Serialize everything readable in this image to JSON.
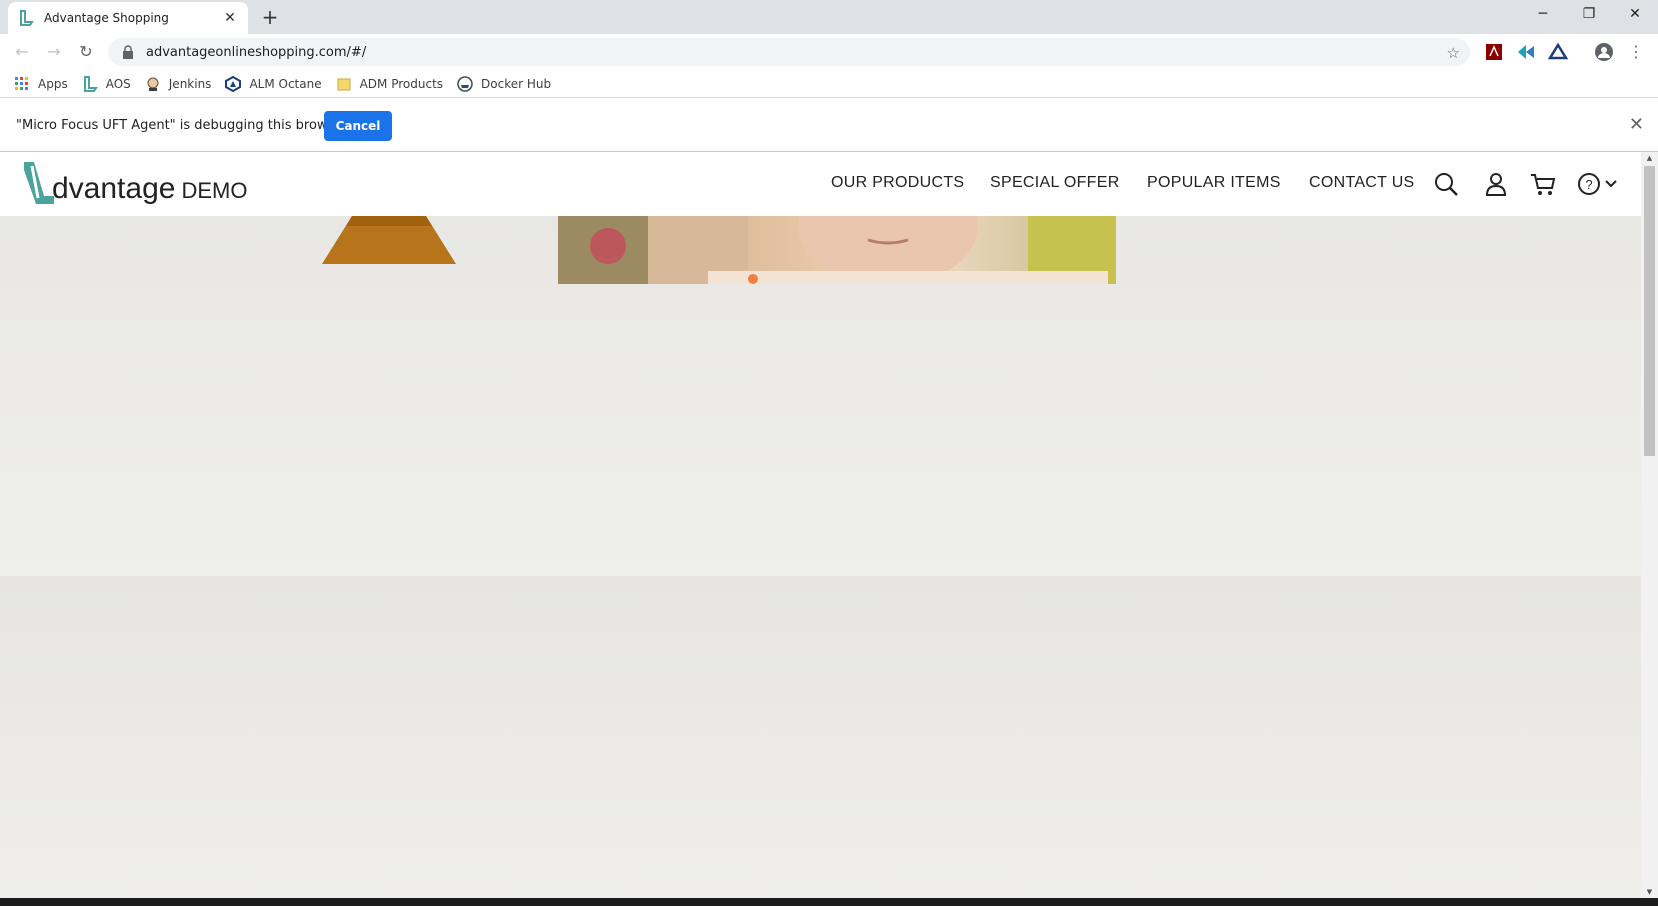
{
  "browser": {
    "tab_title": "Advantage Shopping",
    "url": "advantageonlineshopping.com/#/",
    "bookmarks": [
      "Apps",
      "AOS",
      "Jenkins",
      "ALM Octane",
      "ADM Products",
      "Docker Hub"
    ]
  },
  "infobar": {
    "message": "\"Micro Focus UFT Agent\" is debugging this browser",
    "cancel_label": "Cancel"
  },
  "site": {
    "logo_word": "dvantage",
    "logo_demo": "DEMO",
    "nav": [
      "OUR PRODUCTS",
      "SPECIAL OFFER",
      "POPULAR ITEMS",
      "CONTACT US"
    ],
    "icons": [
      "search-icon",
      "user-icon",
      "cart-icon",
      "help-icon"
    ]
  },
  "colors": {
    "brand_teal": "#4aa39d",
    "button_blue": "#1a73e8"
  }
}
